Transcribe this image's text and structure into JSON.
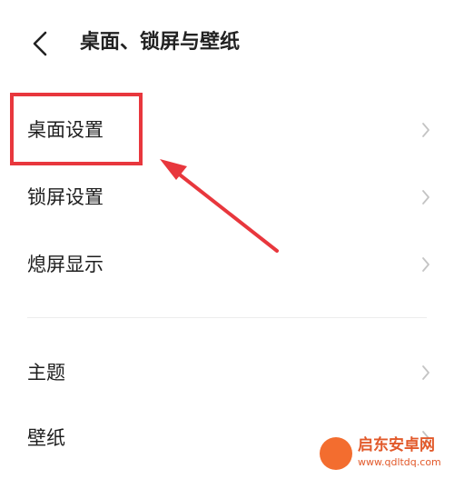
{
  "header": {
    "title": "桌面、锁屏与壁纸",
    "back_icon": "chevron-left-icon"
  },
  "settings": [
    {
      "label": "桌面设置",
      "icon": "chevron-right-icon"
    },
    {
      "label": "锁屏设置",
      "icon": "chevron-right-icon"
    },
    {
      "label": "熄屏显示",
      "icon": "chevron-right-icon"
    },
    {
      "label": "主题",
      "icon": "chevron-right-icon"
    },
    {
      "label": "壁纸",
      "icon": "chevron-right-icon"
    }
  ],
  "annotation": {
    "color": "#e8373d",
    "highlight": "highlight-box",
    "arrow": "arrow"
  },
  "watermark": {
    "name": "启东安卓网",
    "url": "www.qdltdq.com",
    "color": "#e2592a"
  }
}
